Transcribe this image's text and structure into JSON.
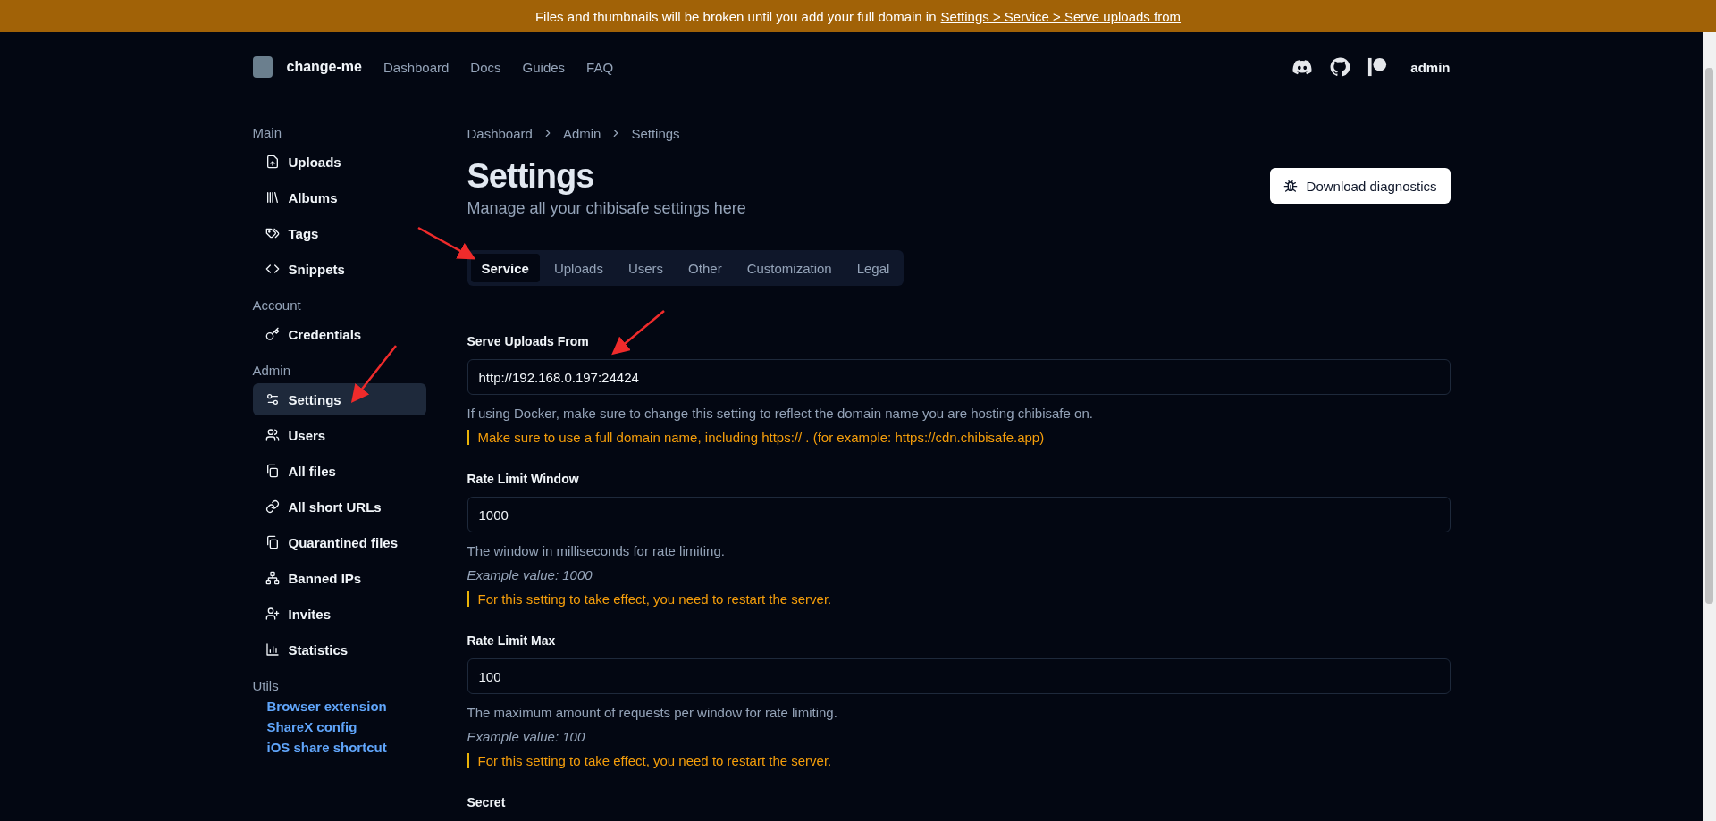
{
  "banner": {
    "text": "Files and thumbnails will be broken until you add your full domain in",
    "link": "Settings > Service > Serve uploads from"
  },
  "header": {
    "brand": "change-me",
    "nav": [
      "Dashboard",
      "Docs",
      "Guides",
      "FAQ"
    ],
    "user": "admin"
  },
  "sidebar": {
    "sections": [
      {
        "title": "Main",
        "items": [
          {
            "label": "Uploads",
            "selected": false
          },
          {
            "label": "Albums",
            "selected": false
          },
          {
            "label": "Tags",
            "selected": false
          },
          {
            "label": "Snippets",
            "selected": false
          }
        ]
      },
      {
        "title": "Account",
        "items": [
          {
            "label": "Credentials",
            "selected": false
          }
        ]
      },
      {
        "title": "Admin",
        "items": [
          {
            "label": "Settings",
            "selected": true
          },
          {
            "label": "Users",
            "selected": false
          },
          {
            "label": "All files",
            "selected": false
          },
          {
            "label": "All short URLs",
            "selected": false
          },
          {
            "label": "Quarantined files",
            "selected": false
          },
          {
            "label": "Banned IPs",
            "selected": false
          },
          {
            "label": "Invites",
            "selected": false
          },
          {
            "label": "Statistics",
            "selected": false
          }
        ]
      }
    ],
    "utils": {
      "title": "Utils",
      "links": [
        "Browser extension",
        "ShareX config",
        "iOS share shortcut"
      ]
    }
  },
  "breadcrumb": [
    "Dashboard",
    "Admin",
    "Settings"
  ],
  "title": "Settings",
  "subtitle": "Manage all your chibisafe settings here",
  "download_button": "Download diagnostics",
  "tabs": [
    {
      "label": "Service",
      "selected": true
    },
    {
      "label": "Uploads",
      "selected": false
    },
    {
      "label": "Users",
      "selected": false
    },
    {
      "label": "Other",
      "selected": false
    },
    {
      "label": "Customization",
      "selected": false
    },
    {
      "label": "Legal",
      "selected": false
    }
  ],
  "fields": [
    {
      "label": "Serve Uploads From",
      "value": "http://192.168.0.197:24424",
      "help": "If using Docker, make sure to change this setting to reflect the domain name you are hosting chibisafe on.",
      "warning": "Make sure to use a full domain name, including https:// . (for example: https://cdn.chibisafe.app)"
    },
    {
      "label": "Rate Limit Window",
      "value": "1000",
      "help": "The window in milliseconds for rate limiting.",
      "example": "Example value: 1000",
      "warning": "For this setting to take effect, you need to restart the server."
    },
    {
      "label": "Rate Limit Max",
      "value": "100",
      "help": "The maximum amount of requests per window for rate limiting.",
      "example": "Example value: 100",
      "warning": "For this setting to take effect, you need to restart the server."
    },
    {
      "label": "Secret"
    }
  ]
}
